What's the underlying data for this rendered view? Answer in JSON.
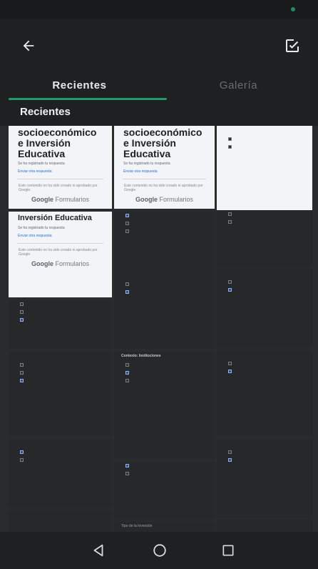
{
  "tabs": {
    "recent": "Recientes",
    "gallery": "Galería"
  },
  "section": {
    "title": "Recientes"
  },
  "thumbs": {
    "t1": {
      "title": "socioeconómico e Inversión Educativa",
      "subtitle": "Se ha registrado tu respuesta",
      "link": "Enviar otra respuesta",
      "footer": "Este contenido no ha sido creado ni aprobado por Google.",
      "google": "Google",
      "forms": "Formularios"
    },
    "t2": {
      "title": "socioeconómico e Inversión Educativa",
      "subtitle": "Se ha registrado tu respuesta",
      "link": "Enviar otra respuesta",
      "footer": "Este contenido no ha sido creado ni aprobado por Google.",
      "google": "Google",
      "forms": "Formularios"
    },
    "t4": {
      "title": "Inversión Educativa",
      "subtitle": "Se ha registrado tu respuesta",
      "link": "Enviar otra respuesta",
      "footer": "Este contenido no ha sido creado ni aprobado por Google.",
      "google": "Google",
      "forms": "Formularios"
    },
    "t8": {
      "q": "Contexto: Instituciones",
      "q2": "Tipo de la Inversión"
    }
  },
  "colors": {
    "accent": "#1b9e68",
    "appbar": "#1f2022"
  },
  "icons": {
    "back": "back-arrow-icon",
    "check": "check-box-icon",
    "navBack": "nav-back-icon",
    "navHome": "nav-home-icon",
    "navRecents": "nav-recents-icon"
  }
}
